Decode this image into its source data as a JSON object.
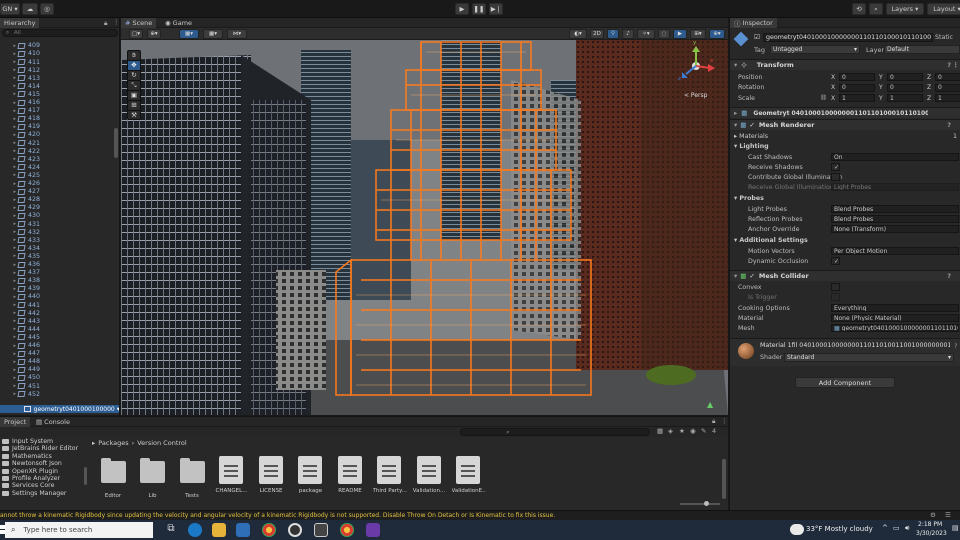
{
  "toolbar": {
    "account_label": "GN ▾",
    "play_icon": "play-icon",
    "pause_icon": "pause-icon",
    "step_icon": "step-icon",
    "layers_label": "Layers",
    "layout_label": "Layout"
  },
  "hierarchy": {
    "tab_label": "Hierarchy",
    "search_placeholder": "All",
    "items": [
      "409",
      "410",
      "411",
      "412",
      "413",
      "414",
      "415",
      "416",
      "417",
      "418",
      "419",
      "420",
      "421",
      "422",
      "423",
      "424",
      "425",
      "426",
      "427",
      "428",
      "429",
      "430",
      "431",
      "432",
      "433",
      "434",
      "435",
      "436",
      "437",
      "438",
      "439",
      "440",
      "441",
      "442",
      "443",
      "444",
      "445",
      "446",
      "447",
      "448",
      "449",
      "450",
      "451",
      "452"
    ],
    "selected_item": "geometryt0401000100000"
  },
  "scene": {
    "tabs": [
      "Scene",
      "Game"
    ],
    "mode_2d": "2D",
    "gizmo_label": "< Persp",
    "gizmo_axes": [
      "x",
      "y",
      "z"
    ]
  },
  "inspector": {
    "tab_label": "Inspector",
    "object_name": "geometryt040100010000000110110100010110100110",
    "static_label": "Static",
    "tag_label": "Tag",
    "tag_value": "Untagged",
    "layer_label": "Layer",
    "layer_value": "Default",
    "transform": {
      "title": "Transform",
      "rows": [
        {
          "label": "Position",
          "x": "0",
          "y": "0",
          "z": "0"
        },
        {
          "label": "Rotation",
          "x": "0",
          "y": "0",
          "z": "0"
        },
        {
          "label": "Scale",
          "x": "1",
          "y": "1",
          "z": "1"
        }
      ]
    },
    "mesh_filter_title": "Geometryt 040100010000000110110100010110100110(Mesh Filter)",
    "mesh_renderer": {
      "title": "Mesh Renderer",
      "materials_label": "Materials",
      "materials_count": "1",
      "lighting_label": "Lighting",
      "cast_shadows_label": "Cast Shadows",
      "cast_shadows_value": "On",
      "receive_shadows_label": "Receive Shadows",
      "receive_shadows_value": "✓",
      "contribute_gi_label": "Contribute Global Illumination",
      "receive_gi_label": "Receive Global Illumination",
      "receive_gi_value": "Light Probes",
      "probes_label": "Probes",
      "light_probes_label": "Light Probes",
      "light_probes_value": "Blend Probes",
      "reflection_probes_label": "Reflection Probes",
      "reflection_probes_value": "Blend Probes",
      "anchor_override_label": "Anchor Override",
      "anchor_override_value": "None (Transform)",
      "additional_label": "Additional Settings",
      "motion_vectors_label": "Motion Vectors",
      "motion_vectors_value": "Per Object Motion",
      "dynamic_occlusion_label": "Dynamic Occlusion",
      "dynamic_occlusion_value": "✓"
    },
    "mesh_collider": {
      "title": "Mesh Collider",
      "convex_label": "Convex",
      "is_trigger_label": "Is Trigger",
      "cooking_label": "Cooking Options",
      "cooking_value": "Everything",
      "material_label": "Material",
      "material_value": "None (Physic Material)",
      "mesh_label": "Mesh",
      "mesh_value": "geometryt040100010000000110110100"
    },
    "material": {
      "title": "Material 1fil 040100010000000110110100110010000000010",
      "shader_label": "Shader",
      "shader_value": "Standard"
    },
    "add_component_label": "Add Component"
  },
  "project": {
    "tabs": [
      "Project",
      "Console"
    ],
    "breadcrumb": [
      "Packages",
      "Version Control"
    ],
    "folders": [
      "Input System",
      "JetBrains Rider Editor",
      "Mathematics",
      "Newtonsoft Json",
      "OpenXR Plugin",
      "Profile Analyzer",
      "Services Core",
      "Settings Manager"
    ],
    "assets": [
      {
        "name": "Editor",
        "kind": "folder"
      },
      {
        "name": "Lib",
        "kind": "folder"
      },
      {
        "name": "Tests",
        "kind": "folder"
      },
      {
        "name": "CHANGEL...",
        "kind": "doc"
      },
      {
        "name": "LICENSE",
        "kind": "doc"
      },
      {
        "name": "package",
        "kind": "doc"
      },
      {
        "name": "README",
        "kind": "doc"
      },
      {
        "name": "Third Party...",
        "kind": "doc"
      },
      {
        "name": "Validation...",
        "kind": "doc"
      },
      {
        "name": "ValidationE...",
        "kind": "doc"
      }
    ],
    "count_badge": "4"
  },
  "status": {
    "message": "annot throw a kinematic Rigidbody since updating the velocity and angular velocity of a kinematic Rigidbody is not supported. Disable Throw On Detach or Is Kinematic to fix this issue."
  },
  "taskbar": {
    "search_placeholder": "Type here to search",
    "weather": "33°F  Mostly cloudy",
    "time": "2:18 PM",
    "date": "3/30/2023"
  },
  "colors": {
    "selection_outline": "#ff7a1a",
    "accent_blue": "#2e6fb8",
    "status_text": "#e0c040"
  }
}
